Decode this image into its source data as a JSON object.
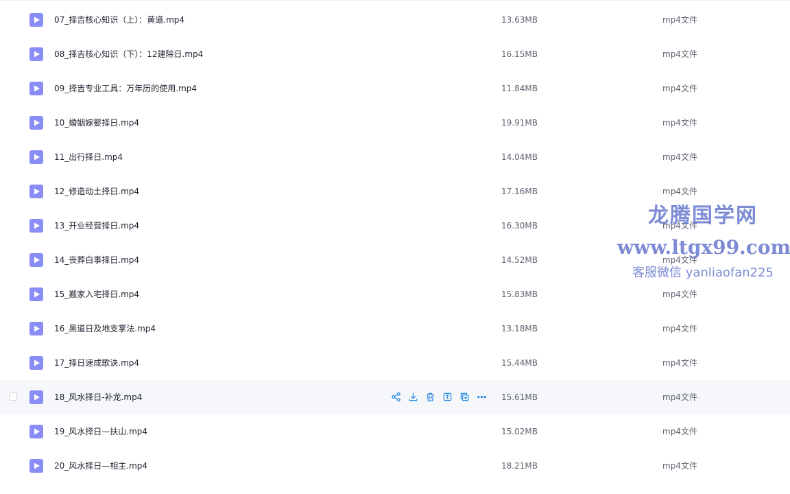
{
  "colors": {
    "icon_fill": "#8b8df6",
    "icon_play": "#ffffff",
    "action_icon": "#2f8de4",
    "hover_row": "#f5f7fa",
    "watermark": "#6f7fd0"
  },
  "icons": {
    "file": "video-file-icon",
    "actions": [
      "share-icon",
      "download-icon",
      "delete-icon",
      "rename-icon",
      "copy-icon",
      "more-icon"
    ]
  },
  "files": [
    {
      "name": "07_择吉核心知识（上）：黄道.mp4",
      "size": "13.63MB",
      "type": "mp4文件"
    },
    {
      "name": "08_择吉核心知识（下）：12建除日.mp4",
      "size": "16.15MB",
      "type": "mp4文件"
    },
    {
      "name": "09_择吉专业工具：万年历的使用.mp4",
      "size": "11.84MB",
      "type": "mp4文件"
    },
    {
      "name": "10_婚姻嫁娶择日.mp4",
      "size": "19.91MB",
      "type": "mp4文件"
    },
    {
      "name": "11_出行择日.mp4",
      "size": "14.04MB",
      "type": "mp4文件"
    },
    {
      "name": "12_修造动土择日.mp4",
      "size": "17.16MB",
      "type": "mp4文件"
    },
    {
      "name": "13_开业经营择日.mp4",
      "size": "16.30MB",
      "type": "mp4文件"
    },
    {
      "name": "14_丧葬白事择日.mp4",
      "size": "14.52MB",
      "type": "mp4文件"
    },
    {
      "name": "15_搬家入宅择日.mp4",
      "size": "15.83MB",
      "type": "mp4文件"
    },
    {
      "name": "16_黑道日及地支掌法.mp4",
      "size": "13.18MB",
      "type": "mp4文件"
    },
    {
      "name": "17_择日速成歌诀.mp4",
      "size": "15.44MB",
      "type": "mp4文件"
    },
    {
      "name": "18_风水择日-补龙.mp4",
      "size": "15.61MB",
      "type": "mp4文件",
      "hovered": true
    },
    {
      "name": "19_风水择日—扶山.mp4",
      "size": "15.02MB",
      "type": "mp4文件"
    },
    {
      "name": "20_风水择日—相主.mp4",
      "size": "18.21MB",
      "type": "mp4文件"
    }
  ],
  "watermark": {
    "line1": "龙腾国学网",
    "line2": "www.ltgx99.com",
    "line3": "客服微信 yanliaofan225"
  }
}
